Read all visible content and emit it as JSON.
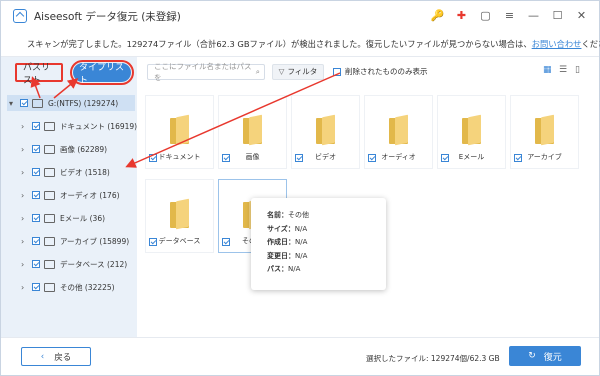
{
  "app": {
    "title": "Aiseesoft データ復元 (未登録)"
  },
  "notice": {
    "text": "スキャンが完了しました。129274ファイル（合計62.3 GBファイル）が検出されました。復元したいファイルが見つからない場合は、",
    "link": "お問い合わせ",
    "tail": "ください。"
  },
  "tabs": {
    "path": "パスリスト",
    "type": "タイプリスト"
  },
  "tree": {
    "root": "G:(NTFS) (129274)",
    "items": [
      {
        "label": "ドキュメント (16919)"
      },
      {
        "label": "画像 (62289)"
      },
      {
        "label": "ビデオ (1518)"
      },
      {
        "label": "オーディオ (176)"
      },
      {
        "label": "Eメール (36)"
      },
      {
        "label": "アーカイブ (15899)"
      },
      {
        "label": "データベース (212)"
      },
      {
        "label": "その他 (32225)"
      }
    ]
  },
  "toolbar": {
    "search_placeholder": "ここにファイル名またはパスを",
    "filter": "フィルタ",
    "deleted_only": "削除されたもののみ表示"
  },
  "grid": {
    "row1": [
      "ドキュメント",
      "画像",
      "ビデオ",
      "オーディオ",
      "Eメール",
      "アーカイブ"
    ],
    "row2": [
      "データベース",
      "その他"
    ]
  },
  "popup": {
    "name_label": "名前：",
    "name_value": "その他",
    "size_label": "サイズ：",
    "size_value": "N/A",
    "created_label": "作成日：",
    "created_value": "N/A",
    "modified_label": "変更日：",
    "modified_value": "N/A",
    "path_label": "パス：",
    "path_value": "N/A"
  },
  "bottom": {
    "back": "戻る",
    "selected": "選択したファイル: 129274個/62.3 GB",
    "restore": "復元"
  },
  "colors": {
    "accent": "#3a86d6",
    "annotation": "#e8382e",
    "folder": "#f5d37c"
  }
}
